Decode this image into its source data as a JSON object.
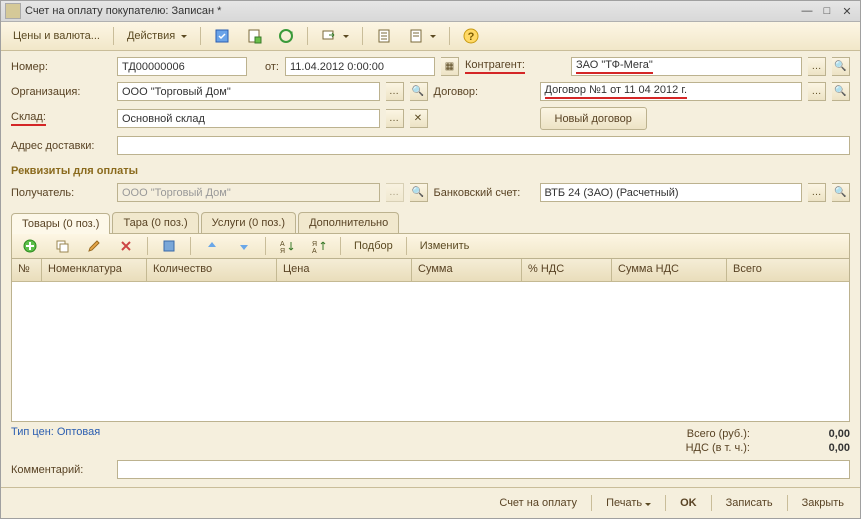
{
  "title": "Счет на оплату покупателю: Записан *",
  "toolbar": {
    "currency": "Цены и валюта...",
    "actions": "Действия"
  },
  "left": {
    "number_label": "Номер:",
    "number_value": "ТД00000006",
    "from_label": "от:",
    "date_value": "11.04.2012  0:00:00",
    "org_label": "Организация:",
    "org_value": "ООО \"Торговый Дом\"",
    "sklad_label": "Склад:",
    "sklad_value": "Основной склад",
    "addr_label": "Адрес доставки:",
    "addr_value": ""
  },
  "right": {
    "contragent_label": "Контрагент:",
    "contragent_value": "ЗАО \"ТФ-Мега\"",
    "dogovor_label": "Договор:",
    "dogovor_value": "Договор №1 от 11 04 2012 г.",
    "new_dogovor": "Новый договор"
  },
  "section_pay": "Реквизиты для оплаты",
  "pay": {
    "recv_label": "Получатель:",
    "recv_value": "ООО \"Торговый Дом\"",
    "bank_label": "Банковский счет:",
    "bank_value": "ВТБ 24 (ЗАО) (Расчетный)"
  },
  "tabs": {
    "goods": "Товары (0 поз.)",
    "tara": "Тара (0 поз.)",
    "services": "Услуги (0 поз.)",
    "more": "Дополнительно"
  },
  "tabtoolbar": {
    "podbor": "Подбор",
    "edit": "Изменить"
  },
  "grid": {
    "col_n": "№",
    "col_nomen": "Номенклатура",
    "col_qty": "Количество",
    "col_price": "Цена",
    "col_sum": "Сумма",
    "col_vatpct": "% НДС",
    "col_vatsum": "Сумма НДС",
    "col_total": "Всего"
  },
  "priceType": "Тип цен: Оптовая",
  "totals": {
    "sum_label": "Всего (руб.):",
    "sum_value": "0,00",
    "vat_label": "НДС (в т. ч.):",
    "vat_value": "0,00"
  },
  "comment_label": "Комментарий:",
  "comment_value": "",
  "buttons": {
    "print_invoice": "Счет на оплату",
    "print": "Печать",
    "ok": "OK",
    "save": "Записать",
    "close": "Закрыть"
  }
}
